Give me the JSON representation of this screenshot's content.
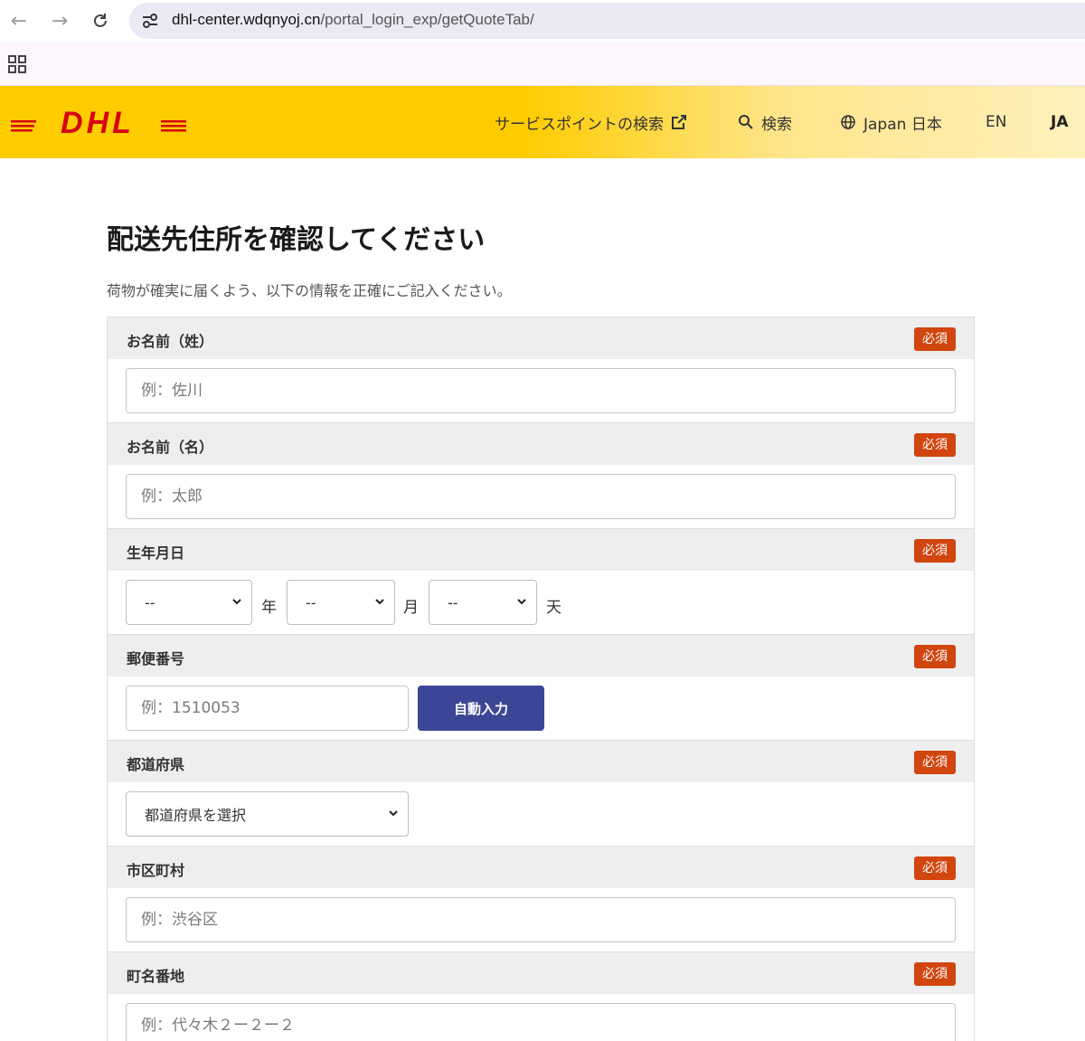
{
  "browser": {
    "url_host": "dhl-center.wdqnyoj.cn",
    "url_path": "/portal_login_exp/getQuoteTab/"
  },
  "header": {
    "brand": "DHL",
    "nav": {
      "service_point": "サービスポイントの検索",
      "search": "検索",
      "region": "Japan 日本",
      "lang_en": "EN",
      "lang_ja": "JA"
    },
    "colors": {
      "brand_yellow": "#ffcc00",
      "brand_red": "#d40511"
    }
  },
  "page": {
    "title": "配送先住所を確認してください",
    "subtitle": "荷物が確実に届くよう、以下の情報を正確にご記入ください。"
  },
  "form": {
    "required_label": "必須",
    "last_name": {
      "label": "お名前（姓）",
      "placeholder": "例：佐川"
    },
    "first_name": {
      "label": "お名前（名）",
      "placeholder": "例：太郎"
    },
    "birthday": {
      "label": "生年月日",
      "year_value": "--",
      "year_unit": "年",
      "month_value": "--",
      "month_unit": "月",
      "day_value": "--",
      "day_unit": "天"
    },
    "postal": {
      "label": "郵便番号",
      "placeholder": "例：1510053",
      "button": "自動入力"
    },
    "prefecture": {
      "label": "都道府県",
      "value": "都道府県を選択"
    },
    "city": {
      "label": "市区町村",
      "placeholder": "例：渋谷区"
    },
    "street": {
      "label": "町名番地",
      "placeholder": "例：代々木２ー２ー２"
    }
  },
  "theme": {
    "required_badge": "#d1450f",
    "button_color": "#3b4696"
  }
}
